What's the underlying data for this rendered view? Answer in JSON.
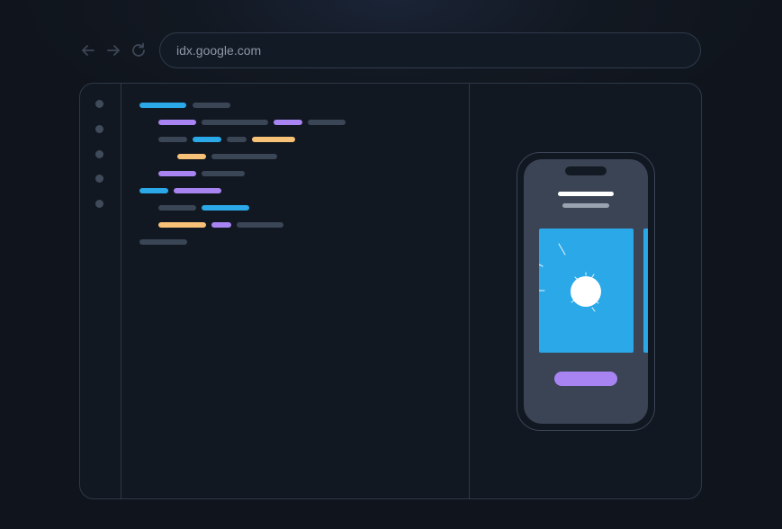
{
  "browser": {
    "url": "idx.google.com",
    "back_icon": "arrow-left-icon",
    "forward_icon": "arrow-right-icon",
    "reload_icon": "reload-icon"
  },
  "colors": {
    "background": "#121821",
    "border": "#2e3847",
    "blue": "#2aa8e8",
    "purple": "#a884f2",
    "orange": "#f7c178",
    "gray": "#3a4556",
    "phone_screen": "#3a4454"
  },
  "editor": {
    "line_marker_count": 5,
    "code_lines": [
      [
        "blue",
        "gray"
      ],
      [
        "purple",
        "gray",
        "purple",
        "gray"
      ],
      [
        "gray",
        "blue",
        "gray",
        "orange"
      ],
      [
        "orange",
        "gray"
      ],
      [
        "purple",
        "gray"
      ],
      [
        "blue",
        "purple"
      ],
      [
        "gray",
        "blue"
      ],
      [
        "orange",
        "purple",
        "gray"
      ],
      [
        "gray"
      ]
    ]
  },
  "preview": {
    "device": "phone",
    "content": [
      "title-bar",
      "subtitle-bar",
      "image-card",
      "next-card-peek",
      "cta-button"
    ],
    "card_icon": "sparkle-circle-icon"
  }
}
